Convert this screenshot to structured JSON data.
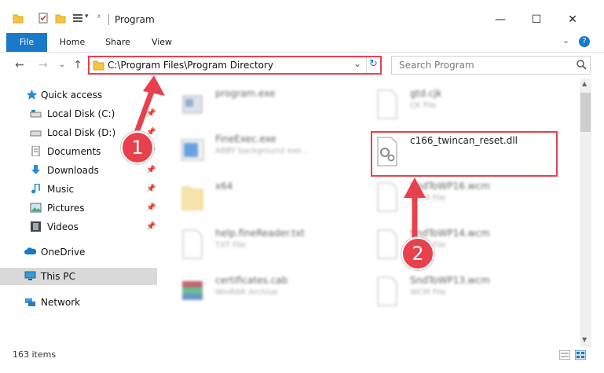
{
  "window": {
    "title": "Program",
    "minimize": "—",
    "maximize": "☐",
    "close": "✕"
  },
  "ribbon": {
    "tabs": [
      "File",
      "Home",
      "Share",
      "View"
    ],
    "expand": "⌄",
    "help": "?"
  },
  "address": {
    "path": "C:\\Program Files\\Program Directory",
    "dropdown": "⌄",
    "refresh": "↻"
  },
  "search": {
    "placeholder": "Search Program",
    "icon": "search-icon"
  },
  "nav": {
    "back": "←",
    "forward": "→",
    "history": "⌄",
    "up": "↑",
    "items": [
      {
        "label": "Quick access",
        "icon": "star-icon",
        "pinned": false
      },
      {
        "label": "Local Disk (C:)",
        "icon": "drive-icon",
        "pinned": true
      },
      {
        "label": "Local Disk (D:)",
        "icon": "drive-icon",
        "pinned": true
      },
      {
        "label": "Documents",
        "icon": "documents-icon",
        "pinned": true
      },
      {
        "label": "Downloads",
        "icon": "downloads-icon",
        "pinned": true
      },
      {
        "label": "Music",
        "icon": "music-icon",
        "pinned": true
      },
      {
        "label": "Pictures",
        "icon": "pictures-icon",
        "pinned": true
      },
      {
        "label": "Videos",
        "icon": "videos-icon",
        "pinned": true
      },
      {
        "label": "OneDrive",
        "icon": "cloud-icon",
        "pinned": false
      },
      {
        "label": "This PC",
        "icon": "computer-icon",
        "pinned": false
      },
      {
        "label": "Network",
        "icon": "network-icon",
        "pinned": false
      }
    ]
  },
  "files_left": [
    {
      "name": "program.exe",
      "type": ""
    },
    {
      "name": "FineExec.exe",
      "type": "ABBY background exe..."
    },
    {
      "name": "x64",
      "type": ""
    },
    {
      "name": "help.fineReader.txt",
      "type": "TXT File"
    },
    {
      "name": "certificates.cab",
      "type": "WinRAR Archive"
    }
  ],
  "files_right": [
    {
      "name": "gtd.cjk",
      "type": "CK File"
    },
    {
      "name": "c166_twincan_reset.dll",
      "type": ""
    },
    {
      "name": "SndToWP16.wcm",
      "type": "WCM File"
    },
    {
      "name": "SndToWP14.wcm",
      "type": "WCM File"
    },
    {
      "name": "SndToWP13.wcm",
      "type": "WCM File"
    }
  ],
  "callouts": [
    "1",
    "2"
  ],
  "status": {
    "items": "163 items"
  },
  "colors": {
    "accent": "#1979ca",
    "highlight": "#e8414e"
  }
}
